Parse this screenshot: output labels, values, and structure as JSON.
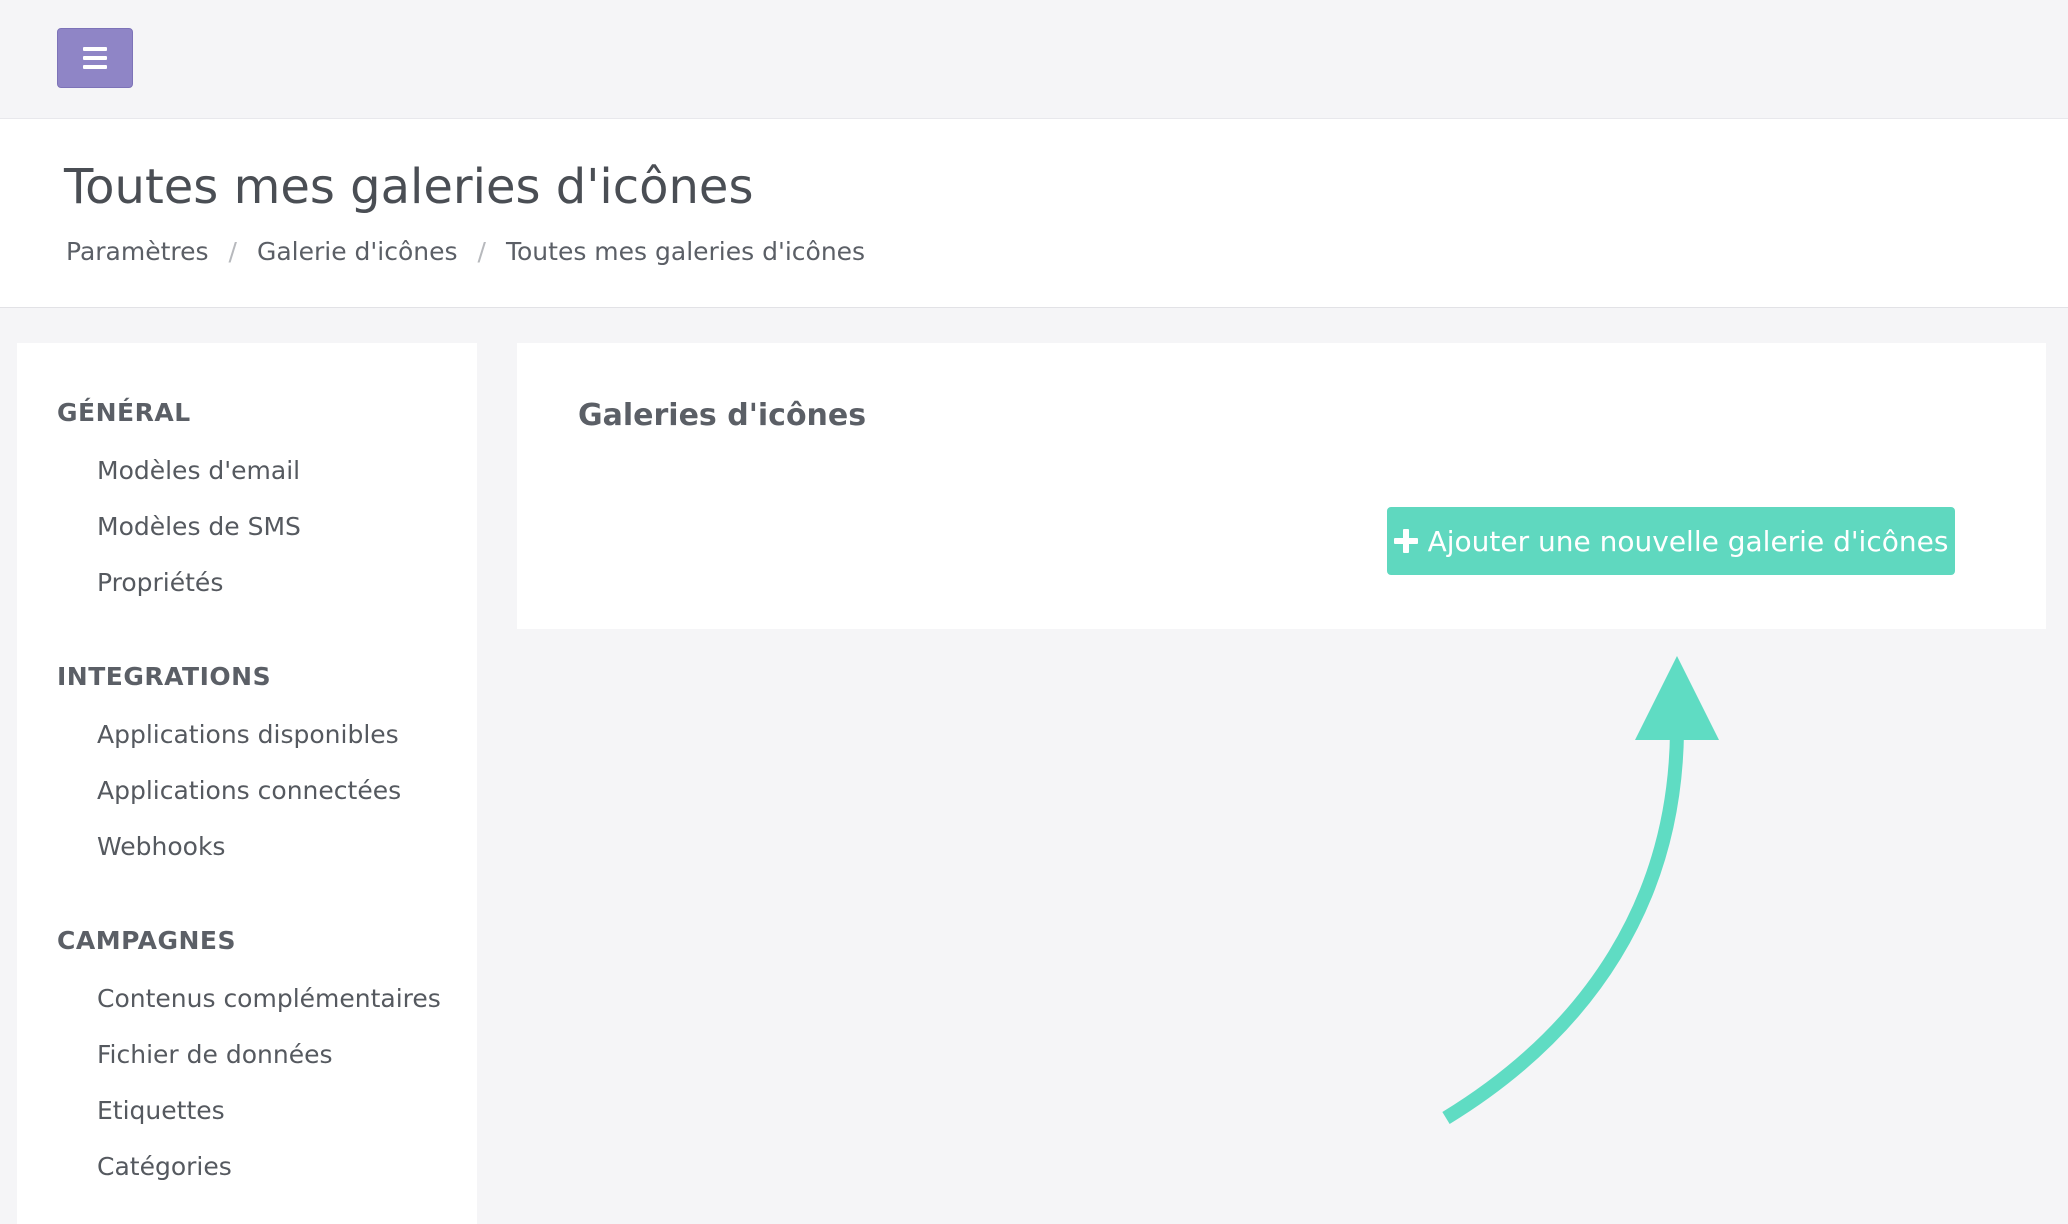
{
  "header": {
    "title": "Toutes mes galeries d'icônes",
    "breadcrumb": [
      "Paramètres",
      "Galerie d'icônes",
      "Toutes mes galeries d'icônes"
    ],
    "separator": "/"
  },
  "sidebar": {
    "sections": [
      {
        "heading": "GÉNÉRAL",
        "items": [
          "Modèles d'email",
          "Modèles de SMS",
          "Propriétés"
        ]
      },
      {
        "heading": "INTEGRATIONS",
        "items": [
          "Applications disponibles",
          "Applications connectées",
          "Webhooks"
        ]
      },
      {
        "heading": "CAMPAGNES",
        "items": [
          "Contenus complémentaires",
          "Fichier de données",
          "Etiquettes",
          "Catégories"
        ]
      }
    ]
  },
  "main": {
    "card_title": "Galeries d'icônes",
    "add_button_label": "Ajouter une nouvelle galerie d'icônes"
  },
  "colors": {
    "menu_button": "#8f85c6",
    "accent": "#5fd8bf",
    "annotation_arrow": "#5fdcc3"
  },
  "icons": {
    "menu": "hamburger-menu-icon",
    "add": "plus-icon",
    "annotation": "curved-arrow-icon"
  }
}
